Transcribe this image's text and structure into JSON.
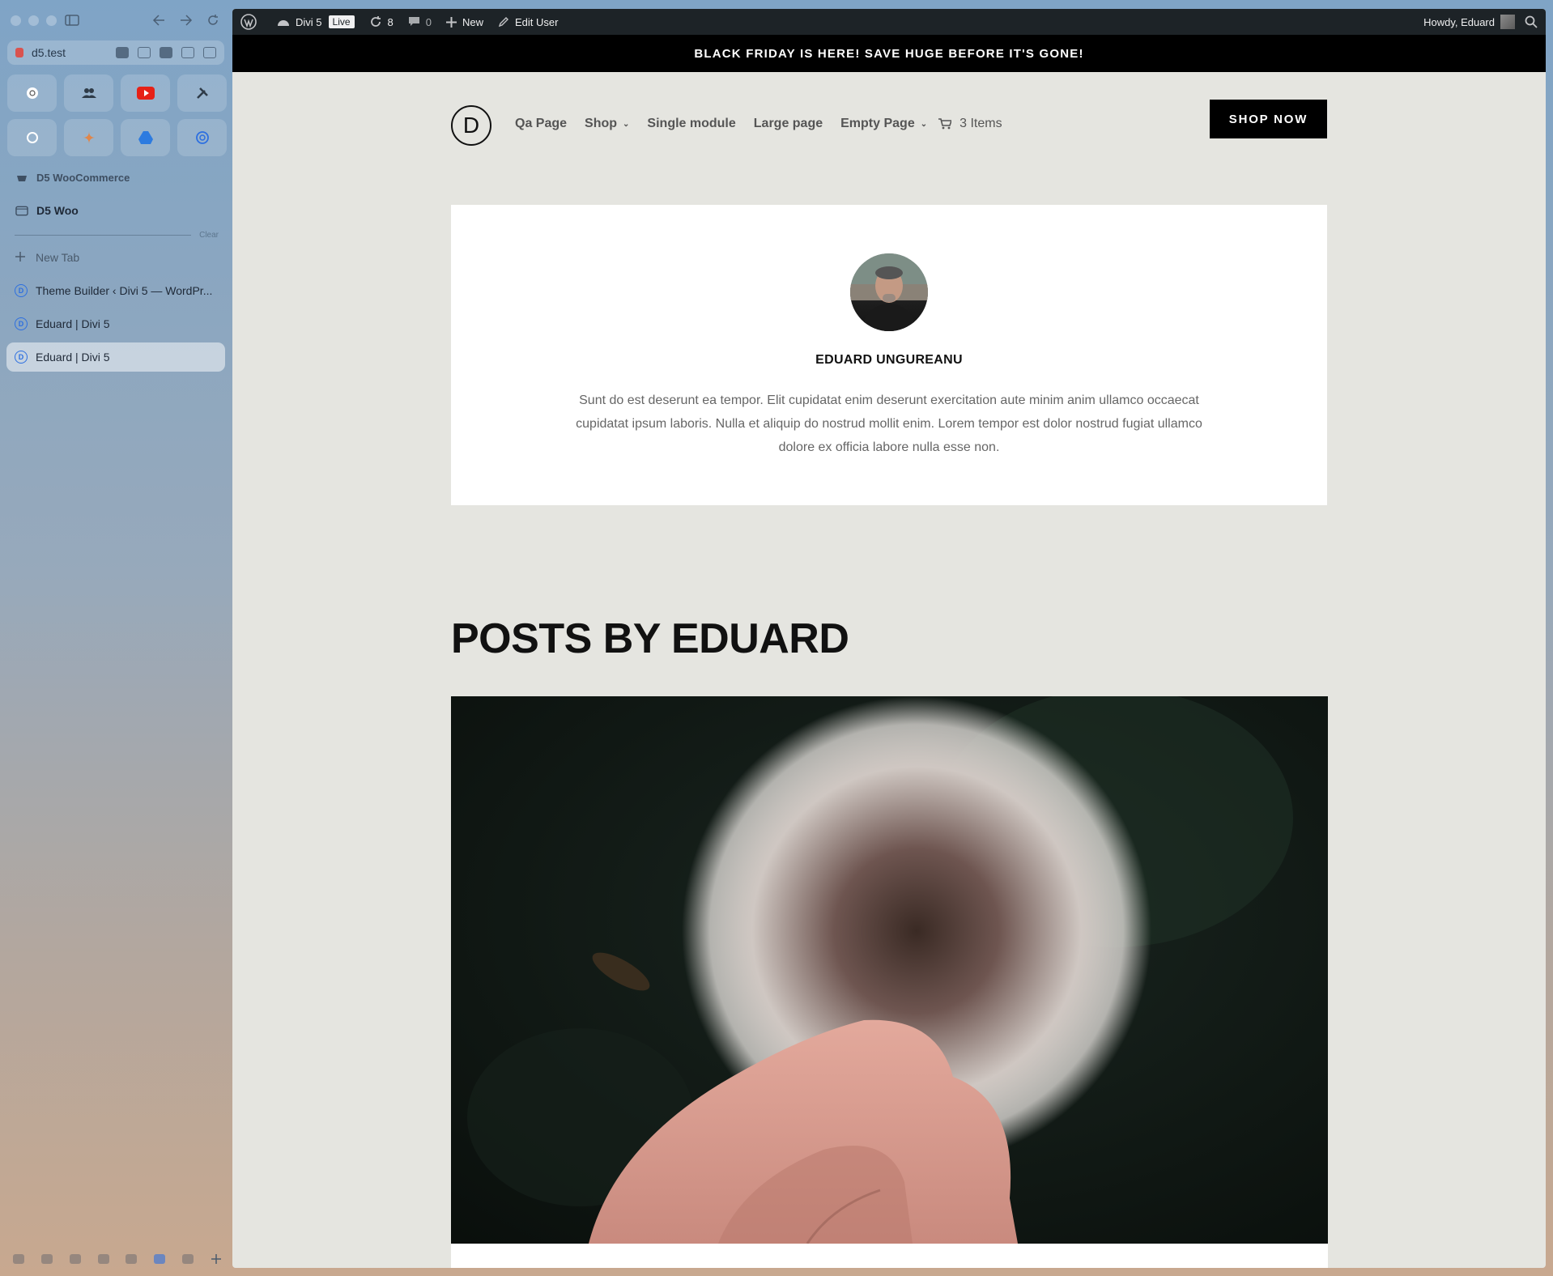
{
  "browser": {
    "url": "d5.test",
    "folder_section_label": "D5 WooCommerce",
    "folder_label": "D5 Woo",
    "clear_label": "Clear",
    "new_tab_label": "New Tab",
    "tabs": [
      {
        "label": "Theme Builder ‹ Divi 5 — WordPr..."
      },
      {
        "label": "Eduard | Divi 5"
      },
      {
        "label": "Eduard | Divi 5"
      }
    ]
  },
  "admin_bar": {
    "site_name": "Divi 5",
    "live_badge": "Live",
    "updates_count": "8",
    "comments_count": "0",
    "new_label": "New",
    "edit_user_label": "Edit User",
    "greeting": "Howdy, Eduard"
  },
  "promo_banner": "BLACK FRIDAY IS HERE! SAVE HUGE BEFORE IT'S GONE!",
  "header": {
    "logo_letter": "D",
    "nav": [
      {
        "label": "Qa Page",
        "has_dropdown": false
      },
      {
        "label": "Shop",
        "has_dropdown": true
      },
      {
        "label": "Single module",
        "has_dropdown": false
      },
      {
        "label": "Large page",
        "has_dropdown": false
      },
      {
        "label": "Empty Page",
        "has_dropdown": true
      }
    ],
    "cart_label": "3 Items",
    "cta_label": "SHOP NOW"
  },
  "author": {
    "name": "EDUARD UNGUREANU",
    "bio": "Sunt do est deserunt ea tempor. Elit cupidatat enim deserunt exercitation aute minim anim ullamco occaecat cupidatat ipsum laboris. Nulla et aliquip do nostrud mollit enim. Lorem tempor est dolor nostrud fugiat ullamco dolore ex officia labore nulla esse non."
  },
  "posts_heading": "POSTS BY EDUARD",
  "colors": {
    "admin_bar": "#1d2327",
    "promo_bg": "#000000",
    "page_bg": "#e5e5e0",
    "accent_tab_icon": "#2d6fe0"
  }
}
